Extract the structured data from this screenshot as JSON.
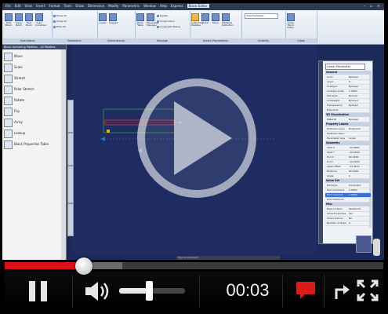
{
  "app": {
    "menus": [
      "File",
      "Edit",
      "View",
      "Insert",
      "Format",
      "Tools",
      "Draw",
      "Dimension",
      "Modify",
      "Parametric",
      "Window",
      "Help",
      "Express"
    ],
    "active_menu_tab": "Block Editor"
  },
  "ribbon": {
    "groups": [
      {
        "label": "Open/Save",
        "buttons": [
          "Edit Block",
          "Save Block",
          "Test Block",
          "Auto Constrain"
        ]
      },
      {
        "label": "Geometric",
        "small": [
          "Show All",
          "Show All",
          "Hide All"
        ]
      },
      {
        "label": "Dimensional",
        "buttons": [
          "Linear",
          "Aligned"
        ]
      },
      {
        "label": "Manage",
        "buttons": [
          "Block Table",
          "Parameter Manager"
        ],
        "small": [
          "Delete",
          "Construction",
          "Constraint Status"
        ]
      },
      {
        "label": "Action Parameters",
        "buttons": [
          "Authoring Palettes",
          "Point",
          "Move",
          "Attribute Definition"
        ]
      },
      {
        "label": "Visibility",
        "combo": "VisibilityState0"
      },
      {
        "label": "Close",
        "buttons": [
          "Close Block Editor"
        ]
      }
    ]
  },
  "palette": {
    "title": "Block Authoring Palettes - All Palettes",
    "items": [
      "Move",
      "Scale",
      "Stretch",
      "Polar Stretch",
      "Rotate",
      "Flip",
      "Array",
      "Lookup",
      "Block Properties Table"
    ],
    "tabs": [
      "Parameters",
      "Actions",
      "Parameter Sets",
      "Constraints"
    ]
  },
  "properties": {
    "selector": "Linear Parameter",
    "sections": [
      {
        "title": "General",
        "rows": [
          [
            "Color",
            "ByLayer"
          ],
          [
            "Layer",
            "0"
          ],
          [
            "Linetype",
            "ByLayer"
          ],
          [
            "Linetype scale",
            "1.0000"
          ],
          [
            "Plot style",
            "ByColor"
          ],
          [
            "Lineweight",
            "ByLayer"
          ],
          [
            "Transparency",
            "ByLayer"
          ],
          [
            "Hyperlink",
            ""
          ]
        ]
      },
      {
        "title": "3D Visualization",
        "rows": [
          [
            "Material",
            "ByLayer"
          ]
        ]
      },
      {
        "title": "Property Labels",
        "rows": [
          [
            "Distance name",
            "Distance1"
          ],
          [
            "Distance descr.",
            ""
          ],
          [
            "Parameter type",
            "Linear"
          ]
        ]
      },
      {
        "title": "Geometry",
        "rows": [
          [
            "Start X",
            "-12.0000"
          ],
          [
            "Start Y",
            "-12.0000"
          ],
          [
            "End X",
            "60.0000"
          ],
          [
            "End Y",
            "-12.0000"
          ],
          [
            "Label offset",
            "-13.4142"
          ],
          [
            "Distance",
            "60.0000"
          ],
          [
            "Angle",
            "0"
          ]
        ]
      },
      {
        "title": "Value Set",
        "rows": [
          [
            "Dist type",
            "Increment"
          ],
          [
            "Dist increment",
            "2.0000"
          ],
          [
            "Dist minimum",
            "2.0000"
          ],
          [
            "Dist maximum",
            ""
          ]
        ]
      },
      {
        "title": "Misc",
        "rows": [
          [
            "Base location",
            "Startpoint"
          ],
          [
            "Show Properties",
            "Yes"
          ],
          [
            "Chain Actions",
            "No"
          ],
          [
            "Number of Grips",
            "2"
          ]
        ]
      }
    ]
  },
  "command_line": {
    "placeholder": "Type a command"
  },
  "player": {
    "time": "00:03",
    "progress": 0.21,
    "buffered": 0.31,
    "volume": 0.45
  }
}
